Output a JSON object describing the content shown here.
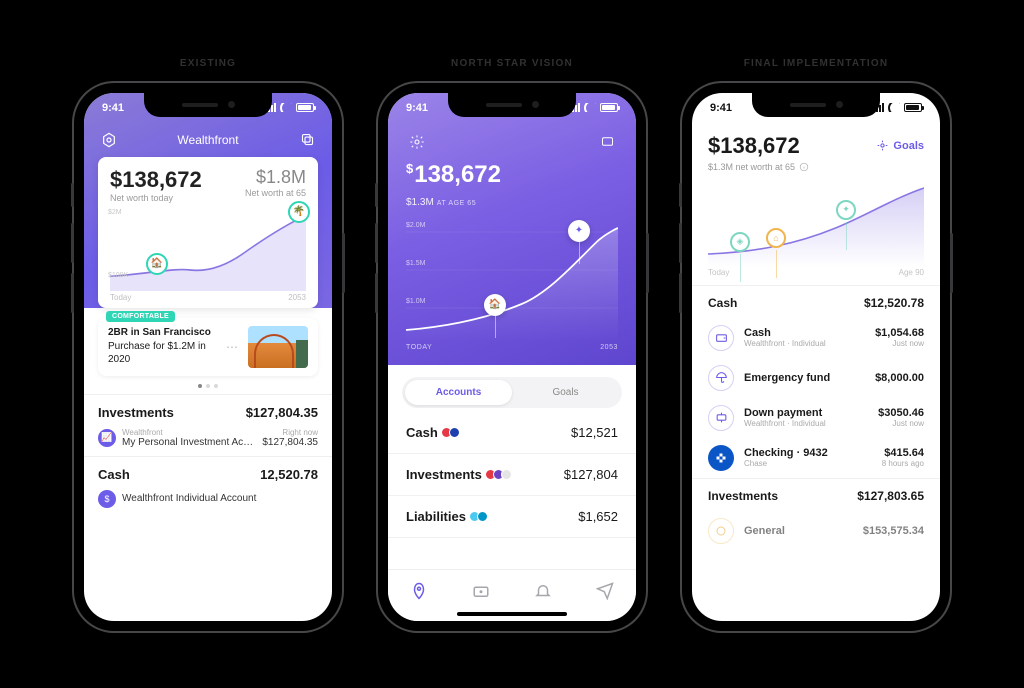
{
  "labels": {
    "col1": "EXISTING",
    "col2": "NORTH STAR VISION",
    "col3": "FINAL IMPLEMENTATION"
  },
  "status": {
    "time": "9:41"
  },
  "p1": {
    "title": "Wealthfront",
    "net_worth_today": "$138,672",
    "net_worth_today_label": "Net worth today",
    "net_worth_future": "$1.8M",
    "net_worth_future_label": "Net worth at 65",
    "y_top": "$2M",
    "y_bot": "$100K",
    "x_left": "Today",
    "x_right": "2053",
    "goal_badge": "COMFORTABLE",
    "goal_title": "2BR in San Francisco",
    "goal_sub": "Purchase for $1.2M in 2020",
    "sec1_title": "Investments",
    "sec1_val": "$127,804.35",
    "sec1_line1_inst": "Wealthfront",
    "sec1_line1_name": "My Personal Investment Ac…",
    "sec1_line1_time": "Right now",
    "sec1_line1_val": "$127,804.35",
    "sec2_title": "Cash",
    "sec2_val": "12,520.78",
    "sec2_line1_name": "Wealthfront Individual Account"
  },
  "p2": {
    "amount": "138,672",
    "future_amt": "$1.3M",
    "future_lbl": "AT AGE 65",
    "y": [
      "$2.0M",
      "$1.5M",
      "$1.0M"
    ],
    "x_left": "TODAY",
    "x_right": "2053",
    "seg_accounts": "Accounts",
    "seg_goals": "Goals",
    "rows": [
      {
        "name": "Cash",
        "val": "$12,521",
        "badges": [
          "#e63946",
          "#1e40af"
        ]
      },
      {
        "name": "Investments",
        "val": "$127,804",
        "badges": [
          "#e63946",
          "#6f42c1",
          "#e5e5e5"
        ]
      },
      {
        "name": "Liabilities",
        "val": "$1,652",
        "badges": [
          "#4cc9f0",
          "#0096c7"
        ]
      }
    ]
  },
  "p3": {
    "amount": "$138,672",
    "sub": "$1.3M net worth at 65",
    "goals": "Goals",
    "x_left": "Today",
    "x_right": "Age 90",
    "cash_header": "Cash",
    "cash_total": "$12,520.78",
    "items": [
      {
        "name": "Cash",
        "sub": "Wealthfront · Individual",
        "val": "$1,054.68",
        "time": "Just now",
        "icon": "wallet",
        "color": "#6c5ce7"
      },
      {
        "name": "Emergency fund",
        "sub": "",
        "val": "$8,000.00",
        "time": "",
        "icon": "umbrella",
        "color": "#6c5ce7"
      },
      {
        "name": "Down payment",
        "sub": "Wealthfront · Individual",
        "val": "$3050.46",
        "time": "Just now",
        "icon": "payment",
        "color": "#6c5ce7"
      },
      {
        "name": "Checking · 9432",
        "sub": "Chase",
        "val": "$415.64",
        "time": "8 hours ago",
        "icon": "chase",
        "color": "#0b56c6"
      }
    ],
    "inv_header": "Investments",
    "inv_total": "$127,803.65",
    "inv_item_name": "General",
    "inv_item_val": "$153,575.34"
  }
}
